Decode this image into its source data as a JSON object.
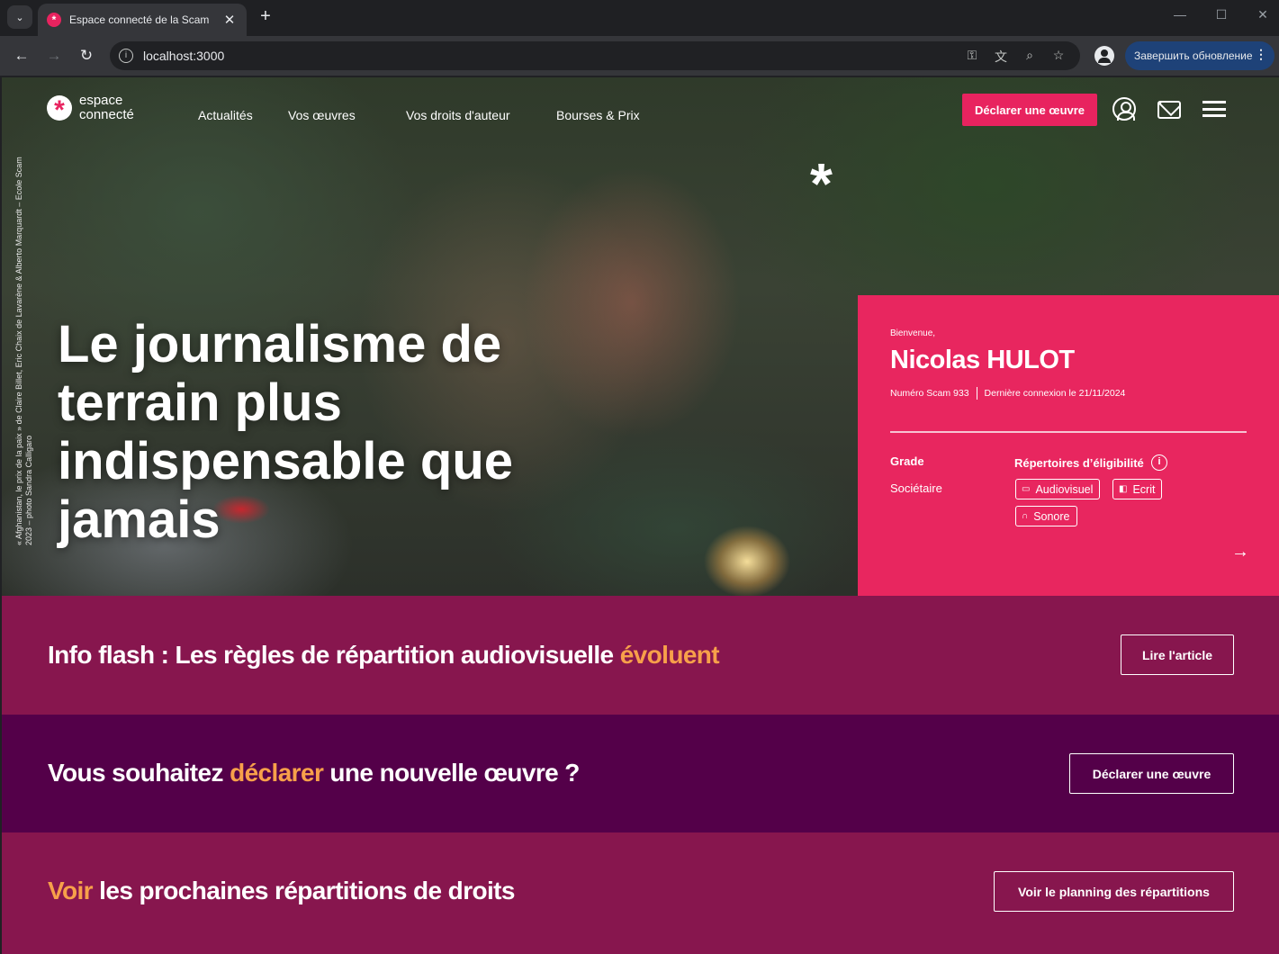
{
  "browser": {
    "tab_title": "Espace connecté de la Scam",
    "tab_favicon": "*",
    "tab_close": "✕",
    "new_tab": "+",
    "url": "localhost:3000",
    "update_label": "Завершить обновление",
    "minimize": "—",
    "maximize": "☐",
    "close": "✕"
  },
  "header": {
    "logo_mark": "*",
    "logo_line1": "espace",
    "logo_line2": "connecté",
    "nav": [
      "Actualités",
      "Vos œuvres",
      "Vos droits d'auteur",
      "Bourses & Prix"
    ],
    "declare_label": "Déclarer une œuvre"
  },
  "hero": {
    "star": "*",
    "title": "Le journalisme de terrain plus indispensable que jamais",
    "credit": "« Afghanistan, le prix de la paix » de Claire Billet, Eric Chaix de Lavarène & Alberto Marquardt – Ecole Scam 2023 – photo Sandra Calligaro"
  },
  "welcome": {
    "greeting": "Bienvenue,",
    "name": "Nicolas HULOT",
    "member_number": "Numéro Scam 933",
    "last_login": "Dernière connexion le 21/11/2024",
    "grade_label": "Grade",
    "grade_value": "Sociétaire",
    "repertoires_label": "Répertoires d’éligibilité",
    "info": "i",
    "tags": [
      "Audiovisuel",
      "Ecrit",
      "Sonore"
    ],
    "arrow": "→"
  },
  "bands": {
    "flash": {
      "before": "Info flash : Les règles de répartition audiovisuelle ",
      "highlight": "évoluent",
      "button": "Lire l'article"
    },
    "declare": {
      "before": "Vous souhaitez ",
      "highlight": "déclarer",
      "after": " une nouvelle œuvre ?",
      "button": "Déclarer une œuvre"
    },
    "planning": {
      "highlight": "Voir",
      "after": " les prochaines répartitions de droits",
      "button": "Voir le planning des répartitions"
    }
  },
  "colors": {
    "brand_pink": "#e8265f",
    "band_flash": "#87164e",
    "band_declare": "#540049",
    "band_planning": "#87164e",
    "highlight": "#f7a04a"
  }
}
